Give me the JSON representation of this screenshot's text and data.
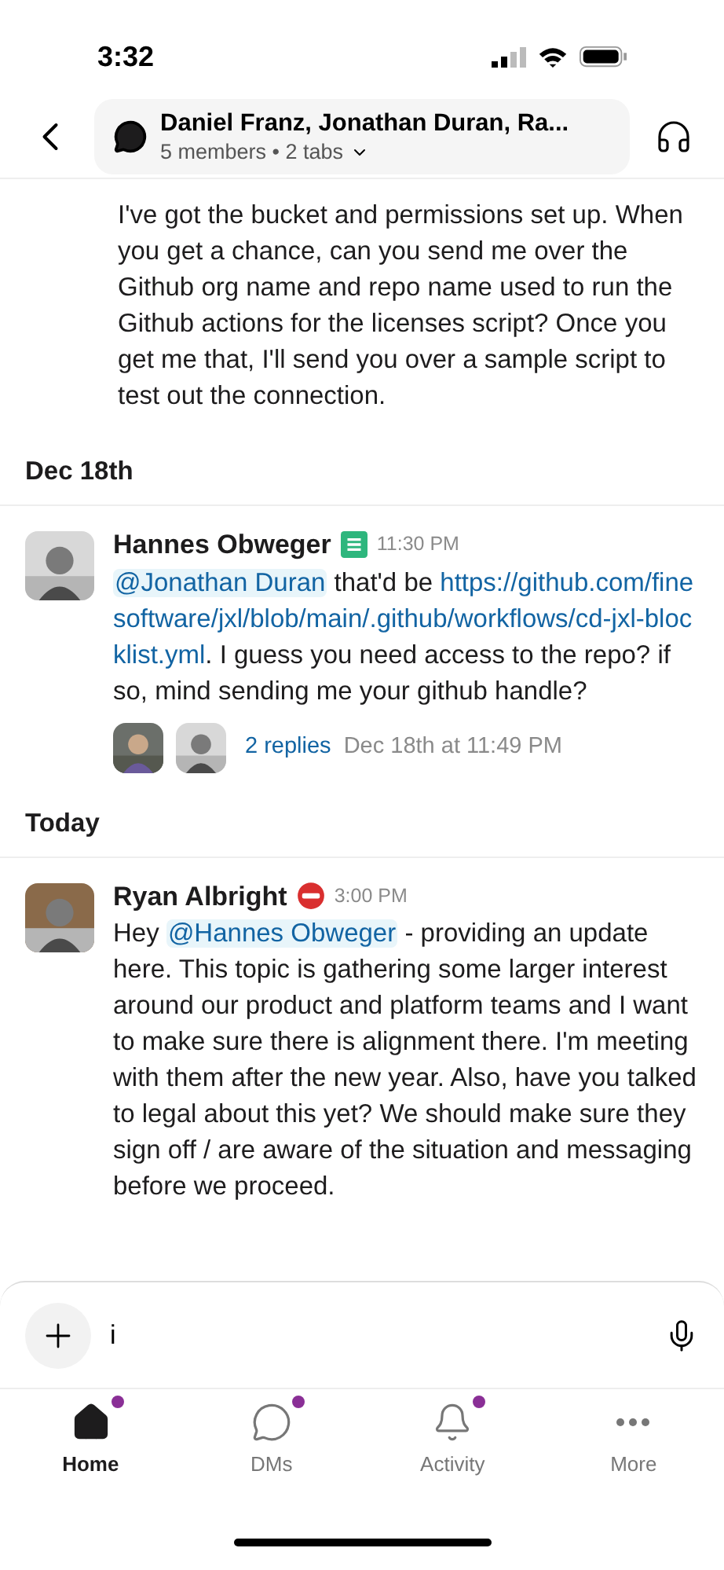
{
  "status_bar": {
    "time": "3:32"
  },
  "header": {
    "title": "Daniel Franz, Jonathan Duran, Ra...",
    "subtitle": "5 members • 2 tabs"
  },
  "feed": [
    {
      "kind": "continuation",
      "body": [
        {
          "kind": "text",
          "text": "I've got the bucket and permissions set up. When you get a chance, can you send me over the Github org name and repo name used to run the Github actions for the licenses script? Once you get me that, I'll send you over a sample script to test out the connection."
        }
      ]
    },
    {
      "kind": "date",
      "label": "Dec 18th"
    },
    {
      "kind": "message",
      "author": "Hannes Obweger",
      "status_emoji": {
        "kind": "notes"
      },
      "time": "11:30 PM",
      "body": [
        {
          "kind": "mention",
          "text": "@Jonathan Duran"
        },
        {
          "kind": "text",
          "text": " that'd be "
        },
        {
          "kind": "link",
          "text": "https://github.com/finesoftware/jxl/blob/main/.github/workflows/cd-jxl-blocklist.yml"
        },
        {
          "kind": "text",
          "text": ". I guess you need access to the repo? if so, mind sending me your github handle?"
        }
      ],
      "thread": {
        "replies": "2 replies",
        "last": "Dec 18th at 11:49 PM"
      }
    },
    {
      "kind": "date",
      "label": "Today"
    },
    {
      "kind": "message",
      "author": "Ryan Albright",
      "status_emoji": {
        "kind": "blocked"
      },
      "time": "3:00 PM",
      "body": [
        {
          "kind": "text",
          "text": "Hey "
        },
        {
          "kind": "mention",
          "text": "@Hannes Obweger"
        },
        {
          "kind": "text",
          "text": " - providing an update here. This topic is gathering some larger interest around our product and platform teams and I want to make sure there is alignment there. I'm meeting with them after the new year. Also, have you talked to legal about this yet? We should make sure they sign off / are aware of the situation and messaging before we proceed."
        }
      ]
    }
  ],
  "composer": {
    "value": "i"
  },
  "tabs": [
    {
      "label": "Home",
      "selected": true,
      "unread": true
    },
    {
      "label": "DMs",
      "selected": false,
      "unread": true
    },
    {
      "label": "Activity",
      "selected": false,
      "unread": true
    },
    {
      "label": "More",
      "selected": false,
      "unread": false
    }
  ]
}
